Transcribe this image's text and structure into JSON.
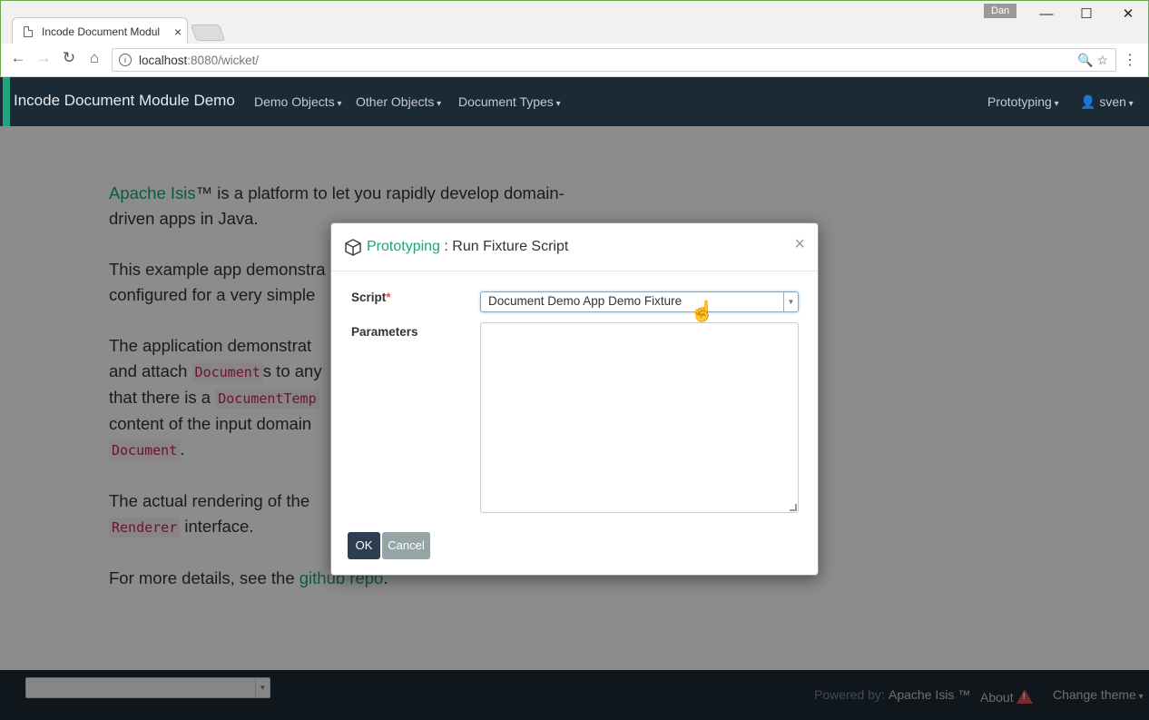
{
  "browser": {
    "tab_title": "Incode Document Modul",
    "tab_close": "×",
    "profile_name": "Dan",
    "url_host": "localhost",
    "url_path": ":8080/wicket/",
    "minimize": "—",
    "maximize": "☐",
    "close": "✕"
  },
  "navbar": {
    "brand": "Incode Document Module Demo",
    "menus": [
      "Demo Objects",
      "Other Objects",
      "Document Types"
    ],
    "prototyping": "Prototyping",
    "user": "sven"
  },
  "content": {
    "p1_link": "Apache Isis",
    "p1_text": "™ is a platform to let you rapidly develop domain-driven apps in Java.",
    "p2_text": "This example app demonstra",
    "p2_text_b": "configured for a very simple",
    "p3_a": "The application demonstrat",
    "p3_b": "and attach ",
    "p3_code1": "Document",
    "p3_c": "s to any",
    "p3_d": "that there is a ",
    "p3_code2": "DocumentTemp",
    "p3_e": "content of the input domain",
    "p3_code3": "Document",
    "p3_f": ".",
    "p4_a": "The actual rendering of the ",
    "p4_code": "Renderer",
    "p4_b": " interface.",
    "p5_a": "For more details, see the ",
    "p5_link": "github repo",
    "p5_b": "."
  },
  "footer": {
    "powered_by": "Powered by:",
    "isis": "Apache Isis ™",
    "about": "About",
    "change_theme": "Change theme"
  },
  "modal": {
    "menu_name": "Prototyping",
    "separator": " : ",
    "action_name": "Run Fixture Script",
    "close": "×",
    "script_label": "Script",
    "required_mark": "*",
    "script_value": "Document Demo App Demo Fixture",
    "parameters_label": "Parameters",
    "parameters_value": "",
    "ok": "OK",
    "cancel": "Cancel"
  },
  "colors": {
    "navbar_bg": "#1c2a36",
    "accent": "#1ea37d",
    "ok_button": "#2c3e50",
    "cancel_button": "#95a5a6"
  }
}
